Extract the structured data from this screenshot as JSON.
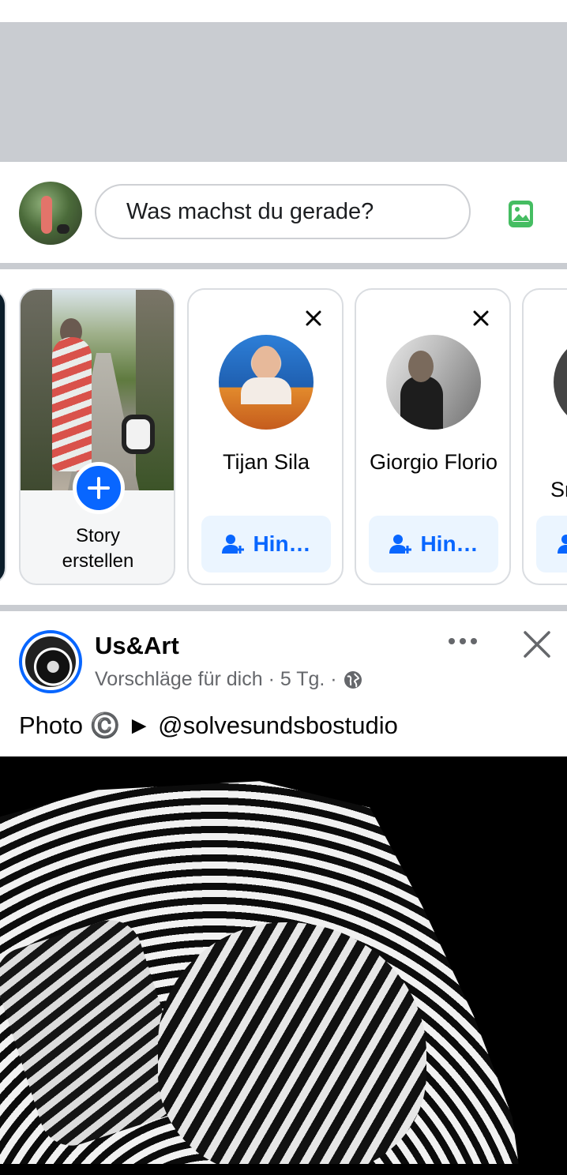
{
  "composer": {
    "placeholder": "Was machst du gerade?"
  },
  "stories": {
    "create_label_line1": "Story",
    "create_label_line2": "erstellen",
    "suggestions": [
      {
        "name": "Tijan Sila",
        "button_label": "Hin…"
      },
      {
        "name": "Giorgio Florio",
        "button_label": "Hin…"
      },
      {
        "name_partial": "Sr"
      }
    ]
  },
  "post": {
    "page_name": "Us&Art",
    "meta_text": "Vorschläge für dich · 5 Tg. ·",
    "caption": "Photo ©️ ► @solvesundsbostudio"
  },
  "icons": [
    "photo-icon",
    "plus-icon",
    "close-icon",
    "add-friend-icon",
    "more-icon",
    "globe-icon"
  ],
  "colors": {
    "accent": "#0866ff",
    "separator": "#c9ccd1",
    "button_bg": "#ebf5ff",
    "meta_text": "#65676b"
  }
}
